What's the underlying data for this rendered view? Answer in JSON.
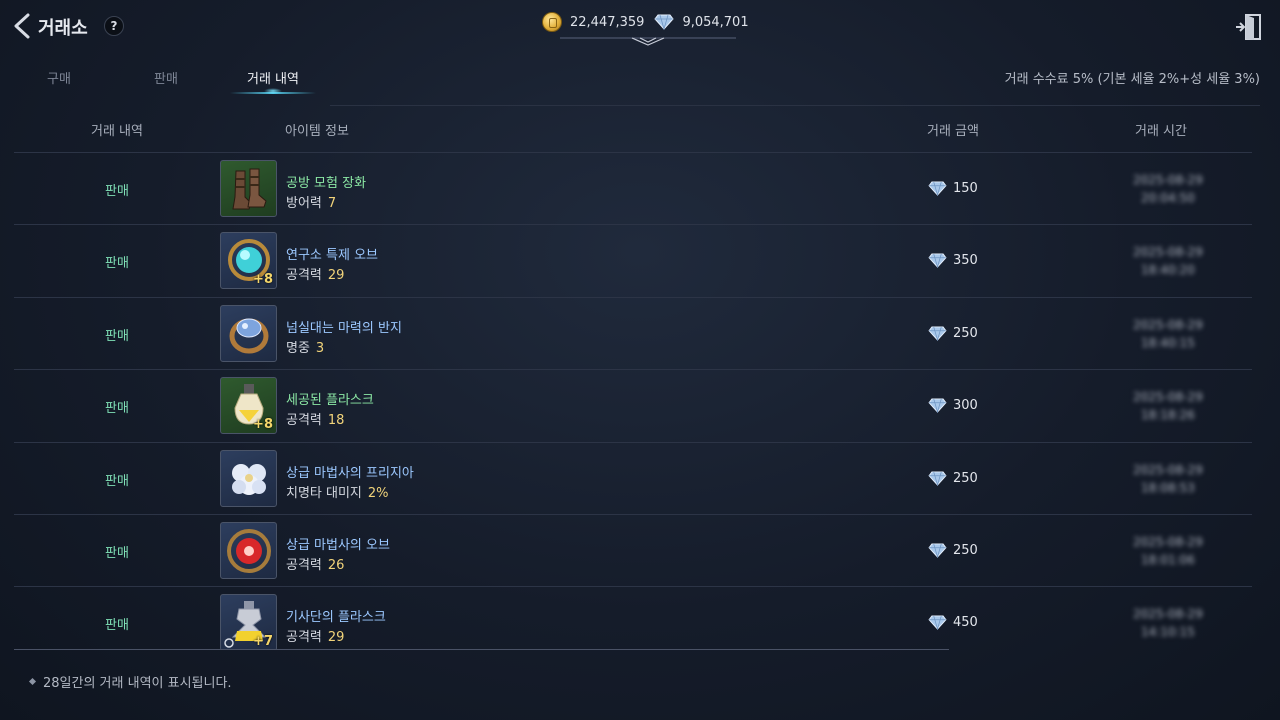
{
  "header": {
    "title": "거래소",
    "help_label": "?",
    "gold": "22,447,359",
    "diamonds": "9,054,701"
  },
  "tabs": [
    {
      "label": "구매",
      "active": false
    },
    {
      "label": "판매",
      "active": false
    },
    {
      "label": "거래 내역",
      "active": true
    }
  ],
  "fee_text": "거래 수수료 5% (기본 세율 2%+성 세율 3%)",
  "table": {
    "headers": [
      "거래 내역",
      "아이템 정보",
      "거래 금액",
      "거래 시간"
    ],
    "rows": [
      {
        "type": "판매",
        "name": "공방 모험 장화",
        "grade": "green",
        "stat_label": "방어력",
        "stat_value": "7",
        "enhance": "",
        "price": "150",
        "time": "2025-08-29 20:04:50",
        "icon": "boots-icon"
      },
      {
        "type": "판매",
        "name": "연구소 특제 오브",
        "grade": "blue",
        "stat_label": "공격력",
        "stat_value": "29",
        "enhance": "+8",
        "price": "350",
        "time": "2025-08-29 18:40:20",
        "icon": "orb-icon"
      },
      {
        "type": "판매",
        "name": "넘실대는 마력의 반지",
        "grade": "blue",
        "stat_label": "명중",
        "stat_value": "3",
        "enhance": "",
        "price": "250",
        "time": "2025-08-29 18:40:15",
        "icon": "ring-icon"
      },
      {
        "type": "판매",
        "name": "세공된 플라스크",
        "grade": "green",
        "stat_label": "공격력",
        "stat_value": "18",
        "enhance": "+8",
        "price": "300",
        "time": "2025-08-29 18:18:26",
        "icon": "flask-icon"
      },
      {
        "type": "판매",
        "name": "상급 마법사의 프리지아",
        "grade": "blue",
        "stat_label": "치명타 대미지",
        "stat_value": "2%",
        "enhance": "",
        "price": "250",
        "time": "2025-08-29 18:08:53",
        "icon": "flower-icon"
      },
      {
        "type": "판매",
        "name": "상급 마법사의 오브",
        "grade": "blue",
        "stat_label": "공격력",
        "stat_value": "26",
        "enhance": "",
        "price": "250",
        "time": "2025-08-29 18:01:06",
        "icon": "red-orb-icon"
      },
      {
        "type": "판매",
        "name": "기사단의 플라스크",
        "grade": "blue",
        "stat_label": "공격력",
        "stat_value": "29",
        "enhance": "+7",
        "price": "450",
        "time": "2025-08-29 14:10:15",
        "icon": "gold-flask-icon"
      }
    ]
  },
  "footer_note": "28일간의 거래 내역이 표시됩니다.",
  "colors": {
    "accent": "#52c8e6",
    "sell_type": "#7fe0b6",
    "grade_green": "#8be7a4",
    "grade_blue": "#9cc8ff",
    "stat_value": "#f1d37a"
  }
}
